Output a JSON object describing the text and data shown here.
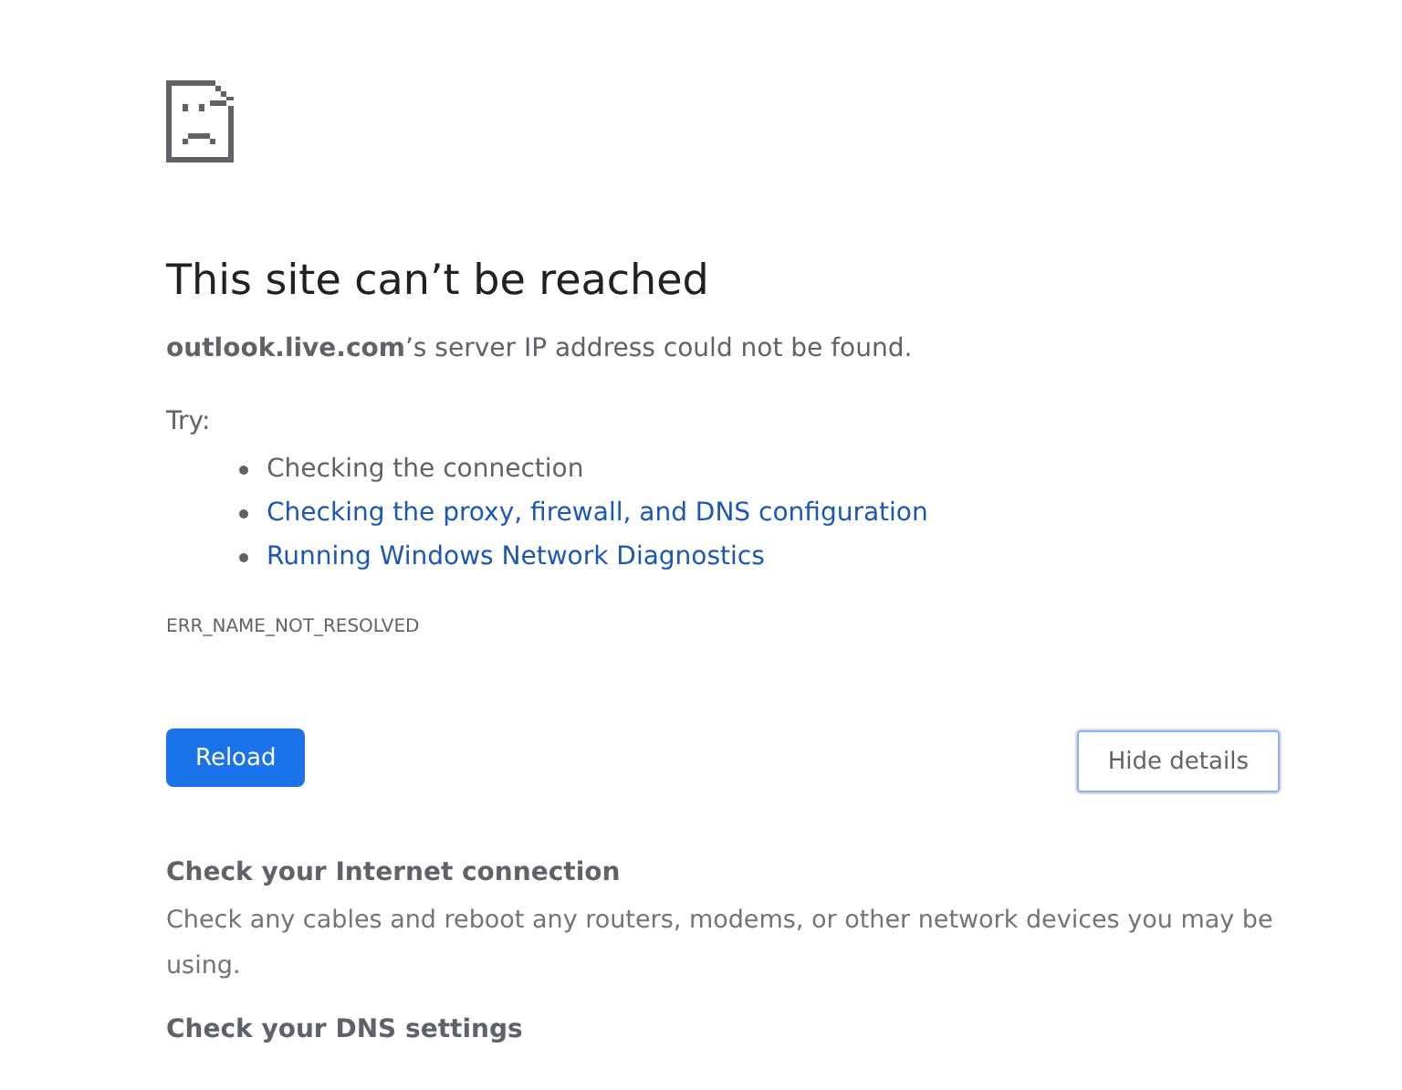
{
  "heading": "This site can’t be reached",
  "summary": "**outlook.live.com**’s server IP address could not be found.",
  "try_label": "Try:",
  "suggestions": [
    {
      "kind": "text",
      "text": "Checking the connection"
    },
    {
      "kind": "link",
      "text": "Checking the proxy, firewall, and DNS configuration"
    },
    {
      "kind": "link",
      "text": "Running Windows Network Diagnostics"
    }
  ],
  "error_code": "ERR_NAME_NOT_RESOLVED",
  "buttons": {
    "reload": "Reload",
    "details": "Hide details"
  },
  "details": [
    {
      "heading": "Check your Internet connection",
      "body": "Check any cables and reboot any routers, modems, or other network devices you may be using."
    },
    {
      "heading": "Check your DNS settings"
    }
  ]
}
